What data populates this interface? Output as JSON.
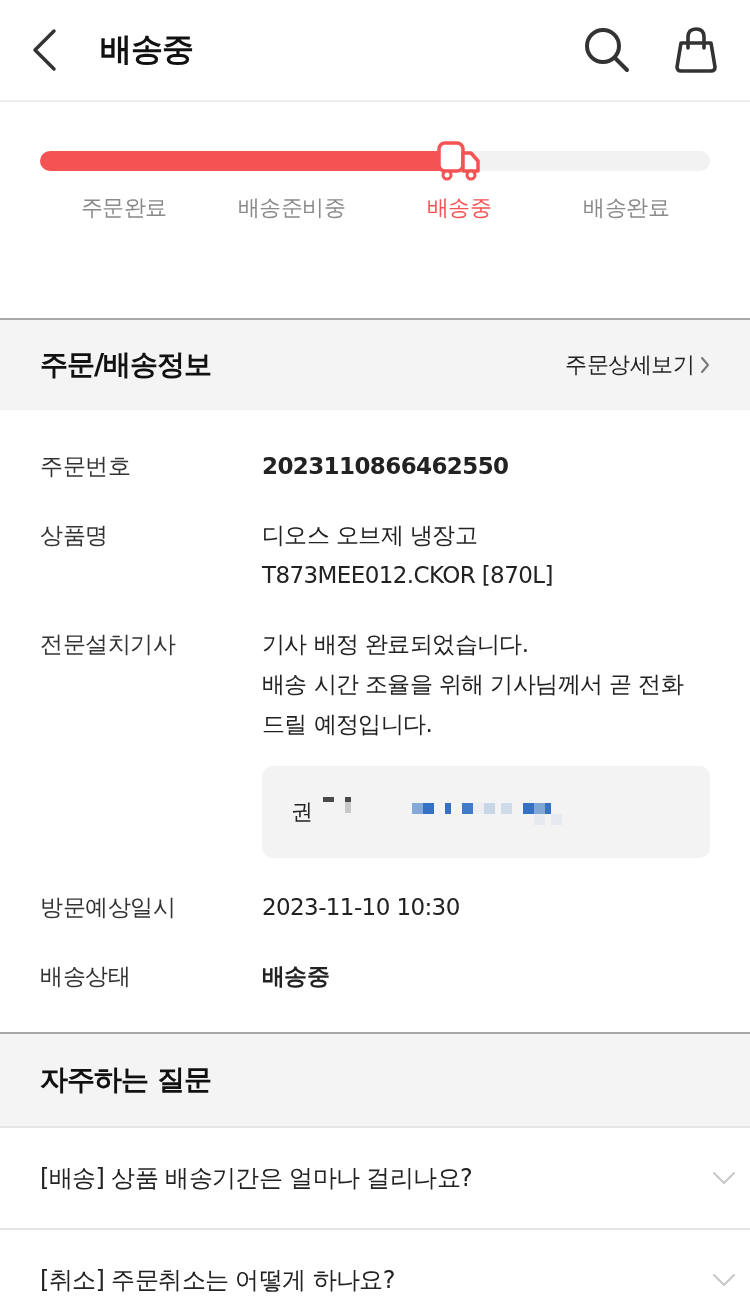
{
  "header": {
    "title": "배송중"
  },
  "progress": {
    "level": 0.625,
    "steps": [
      {
        "label": "주문완료",
        "selected": false
      },
      {
        "label": "배송준비중",
        "selected": false
      },
      {
        "label": "배송중",
        "selected": true
      },
      {
        "label": "배송완료",
        "selected": false
      }
    ]
  },
  "order_info": {
    "title": "주문/배송정보",
    "link": "주문상세보기",
    "rows": [
      {
        "label": "주문번호",
        "lines": [
          "2023110866462550"
        ],
        "bold": true
      },
      {
        "label": "상품명",
        "lines": [
          "디오스 오브제 냉장고",
          "T873MEE012.CKOR [870L]"
        ],
        "bold": false
      },
      {
        "label": "전문설치기사",
        "lines": [
          "기사 배정 완료되었습니다.",
          "배송 시간 조율을 위해 기사님께서 곧 전화",
          "드릴 예정입니다."
        ],
        "bold": false,
        "contact": {
          "name": "권",
          "redacted": true
        }
      },
      {
        "label": "방문예상일시",
        "lines": [
          "2023-11-10 10:30"
        ],
        "bold": false
      },
      {
        "label": "배송상태",
        "lines": [
          "배송중"
        ],
        "bold": true
      }
    ]
  },
  "faq": {
    "title": "자주하는 질문",
    "items": [
      {
        "question": "[배송] 상품 배송기간은 얼마나 걸리나요?",
        "expanded": false
      },
      {
        "question": "[취소] 주문취소는 어떻게 하나요?",
        "expanded": false
      }
    ]
  }
}
